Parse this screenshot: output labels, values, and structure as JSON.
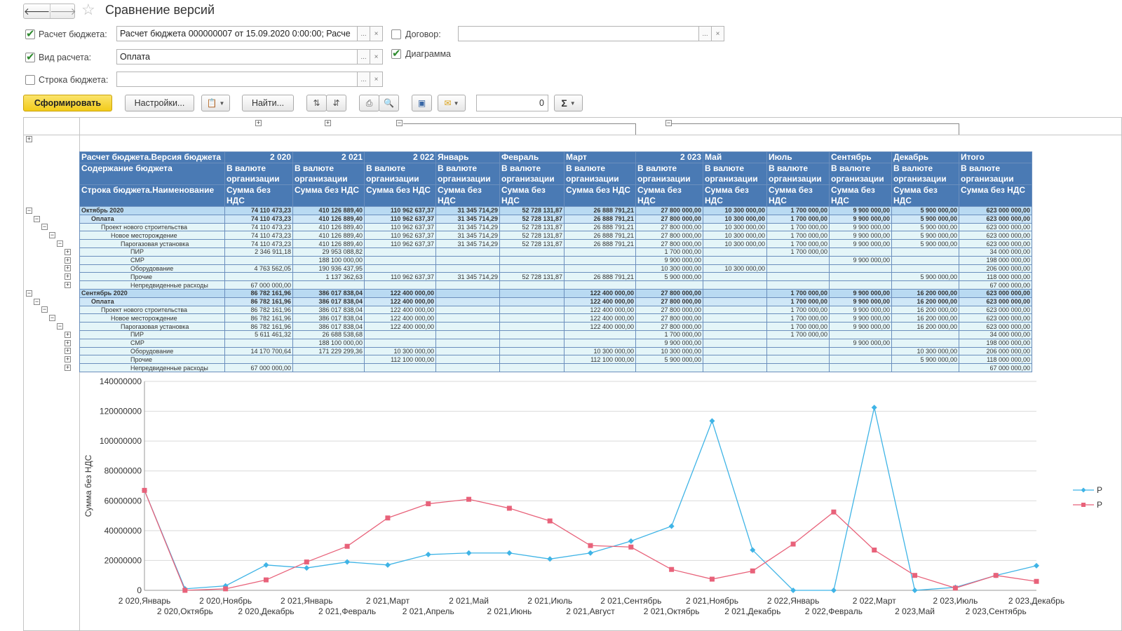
{
  "window": {
    "title": "Сравнение версий",
    "back_icon": "arrow-left-icon",
    "forward_icon": "arrow-right-icon"
  },
  "filters": {
    "budget_calc": {
      "label": "Расчет бюджета:",
      "checked": true,
      "value": "Расчет бюджета 000000007 от 15.09.2020 0:00:00; Расче",
      "btn_more": "...",
      "btn_clear": "×"
    },
    "calc_type": {
      "label": "Вид расчета:",
      "checked": true,
      "value": "Оплата",
      "btn_more": "...",
      "btn_clear": "×"
    },
    "budget_line": {
      "label": "Строка бюджета:",
      "checked": false,
      "value": "",
      "btn_more": "...",
      "btn_clear": "×"
    },
    "contract": {
      "label": "Договор:",
      "checked": false,
      "value": "",
      "btn_more": "...",
      "btn_clear": "×"
    },
    "diagram": {
      "label": "Диаграмма",
      "checked": true
    }
  },
  "toolbar": {
    "generate": "Сформировать",
    "settings": "Настройки...",
    "find": "Найти...",
    "counter": "0",
    "sum_symbol": "Σ",
    "primary_color": "#f5d12c"
  },
  "report": {
    "header_row1": [
      "Расчет бюджета.Версия бюджета",
      "2 020",
      "2 021",
      "2 022",
      "Январь",
      "Февраль",
      "Март",
      "2 023",
      "Май",
      "Июль",
      "Сентябрь",
      "Декабрь",
      "Итого"
    ],
    "header_row2_label": "Содержание бюджета",
    "header_row2_cell": "В валюте организации",
    "header_row3_label": "Строка бюджета.Наименование",
    "header_row3_cell": "Сумма без НДС",
    "rows": [
      {
        "level": 0,
        "name": "Октябрь 2020",
        "values": [
          "74 110 473,23",
          "410 126 889,40",
          "110 962 637,37",
          "31 345 714,29",
          "52 728 131,87",
          "26 888 791,21",
          "27 800 000,00",
          "10 300 000,00",
          "1 700 000,00",
          "9 900 000,00",
          "5 900 000,00",
          "623 000 000,00"
        ]
      },
      {
        "level": 1,
        "name": "Оплата",
        "values": [
          "74 110 473,23",
          "410 126 889,40",
          "110 962 637,37",
          "31 345 714,29",
          "52 728 131,87",
          "26 888 791,21",
          "27 800 000,00",
          "10 300 000,00",
          "1 700 000,00",
          "9 900 000,00",
          "5 900 000,00",
          "623 000 000,00"
        ]
      },
      {
        "level": 2,
        "name": "Проект нового строительства",
        "values": [
          "74 110 473,23",
          "410 126 889,40",
          "110 962 637,37",
          "31 345 714,29",
          "52 728 131,87",
          "26 888 791,21",
          "27 800 000,00",
          "10 300 000,00",
          "1 700 000,00",
          "9 900 000,00",
          "5 900 000,00",
          "623 000 000,00"
        ]
      },
      {
        "level": 3,
        "name": "Новое месторождение",
        "values": [
          "74 110 473,23",
          "410 126 889,40",
          "110 962 637,37",
          "31 345 714,29",
          "52 728 131,87",
          "26 888 791,21",
          "27 800 000,00",
          "10 300 000,00",
          "1 700 000,00",
          "9 900 000,00",
          "5 900 000,00",
          "623 000 000,00"
        ]
      },
      {
        "level": 4,
        "name": "Парогазовая установка",
        "values": [
          "74 110 473,23",
          "410 126 889,40",
          "110 962 637,37",
          "31 345 714,29",
          "52 728 131,87",
          "26 888 791,21",
          "27 800 000,00",
          "10 300 000,00",
          "1 700 000,00",
          "9 900 000,00",
          "5 900 000,00",
          "623 000 000,00"
        ]
      },
      {
        "level": 5,
        "name": "ПИР",
        "values": [
          "2 346 911,18",
          "29 953 088,82",
          "",
          "",
          "",
          "",
          "1 700 000,00",
          "",
          "1 700 000,00",
          "",
          "",
          "34 000 000,00"
        ]
      },
      {
        "level": 5,
        "name": "СМР",
        "values": [
          "",
          "188 100 000,00",
          "",
          "",
          "",
          "",
          "9 900 000,00",
          "",
          "",
          "9 900 000,00",
          "",
          "198 000 000,00"
        ]
      },
      {
        "level": 5,
        "name": "Оборудование",
        "values": [
          "4 763 562,05",
          "190 936 437,95",
          "",
          "",
          "",
          "",
          "10 300 000,00",
          "10 300 000,00",
          "",
          "",
          "",
          "206 000 000,00"
        ]
      },
      {
        "level": 5,
        "name": "Прочие",
        "values": [
          "",
          "1 137 362,63",
          "110 962 637,37",
          "31 345 714,29",
          "52 728 131,87",
          "26 888 791,21",
          "5 900 000,00",
          "",
          "",
          "",
          "5 900 000,00",
          "118 000 000,00"
        ]
      },
      {
        "level": 5,
        "name": "Непредвиденные расходы",
        "values": [
          "67 000 000,00",
          "",
          "",
          "",
          "",
          "",
          "",
          "",
          "",
          "",
          "",
          "67 000 000,00"
        ]
      },
      {
        "level": 0,
        "name": "Сентябрь 2020",
        "values": [
          "86 782 161,96",
          "386 017 838,04",
          "122 400 000,00",
          "",
          "",
          "122 400 000,00",
          "27 800 000,00",
          "",
          "1 700 000,00",
          "9 900 000,00",
          "16 200 000,00",
          "623 000 000,00"
        ]
      },
      {
        "level": 1,
        "name": "Оплата",
        "values": [
          "86 782 161,96",
          "386 017 838,04",
          "122 400 000,00",
          "",
          "",
          "122 400 000,00",
          "27 800 000,00",
          "",
          "1 700 000,00",
          "9 900 000,00",
          "16 200 000,00",
          "623 000 000,00"
        ]
      },
      {
        "level": 2,
        "name": "Проект нового строительства",
        "values": [
          "86 782 161,96",
          "386 017 838,04",
          "122 400 000,00",
          "",
          "",
          "122 400 000,00",
          "27 800 000,00",
          "",
          "1 700 000,00",
          "9 900 000,00",
          "16 200 000,00",
          "623 000 000,00"
        ]
      },
      {
        "level": 3,
        "name": "Новое месторождение",
        "values": [
          "86 782 161,96",
          "386 017 838,04",
          "122 400 000,00",
          "",
          "",
          "122 400 000,00",
          "27 800 000,00",
          "",
          "1 700 000,00",
          "9 900 000,00",
          "16 200 000,00",
          "623 000 000,00"
        ]
      },
      {
        "level": 4,
        "name": "Парогазовая установка",
        "values": [
          "86 782 161,96",
          "386 017 838,04",
          "122 400 000,00",
          "",
          "",
          "122 400 000,00",
          "27 800 000,00",
          "",
          "1 700 000,00",
          "9 900 000,00",
          "16 200 000,00",
          "623 000 000,00"
        ]
      },
      {
        "level": 5,
        "name": "ПИР",
        "values": [
          "5 611 461,32",
          "26 688 538,68",
          "",
          "",
          "",
          "",
          "1 700 000,00",
          "",
          "1 700 000,00",
          "",
          "",
          "34 000 000,00"
        ]
      },
      {
        "level": 5,
        "name": "СМР",
        "values": [
          "",
          "188 100 000,00",
          "",
          "",
          "",
          "",
          "9 900 000,00",
          "",
          "",
          "9 900 000,00",
          "",
          "198 000 000,00"
        ]
      },
      {
        "level": 5,
        "name": "Оборудование",
        "values": [
          "14 170 700,64",
          "171 229 299,36",
          "10 300 000,00",
          "",
          "",
          "10 300 000,00",
          "10 300 000,00",
          "",
          "",
          "",
          "10 300 000,00",
          "206 000 000,00"
        ]
      },
      {
        "level": 5,
        "name": "Прочие",
        "values": [
          "",
          "",
          "112 100 000,00",
          "",
          "",
          "112 100 000,00",
          "5 900 000,00",
          "",
          "",
          "",
          "5 900 000,00",
          "118 000 000,00"
        ]
      },
      {
        "level": 5,
        "name": "Непредвиденные расходы",
        "values": [
          "67 000 000,00",
          "",
          "",
          "",
          "",
          "",
          "",
          "",
          "",
          "",
          "",
          "67 000 000,00"
        ]
      }
    ]
  },
  "chart_data": {
    "type": "line",
    "ylabel": "Сумма без НДС",
    "xlabel": "",
    "ylim": [
      0,
      140000000
    ],
    "yticks": [
      0,
      20000000,
      40000000,
      60000000,
      80000000,
      100000000,
      120000000,
      140000000
    ],
    "grid": true,
    "legend": "right",
    "categories": [
      "2 020,Январь",
      "2 020,Октябрь",
      "2 020,Ноябрь",
      "2 020,Декабрь",
      "2 021,Январь",
      "2 021,Февраль",
      "2 021,Март",
      "2 021,Апрель",
      "2 021,Май",
      "2 021,Июнь",
      "2 021,Июль",
      "2 021,Август",
      "2 021,Сентябрь",
      "2 021,Октябрь",
      "2 021,Ноябрь",
      "2 021,Декабрь",
      "2 022,Январь",
      "2 022,Февраль",
      "2 022,Март",
      "2 023,Май",
      "2 023,Июль",
      "2 023,Сентябрь",
      "2 023,Декабрь"
    ],
    "series": [
      {
        "name": "Р",
        "color": "#3fb4e6",
        "marker": "diamond",
        "values": [
          67000000,
          1000000,
          3000000,
          17000000,
          15000000,
          19000000,
          17000000,
          24000000,
          25000000,
          25000000,
          21000000,
          25000000,
          33000000,
          43000000,
          113500000,
          27000000,
          0,
          0,
          122500000,
          0,
          2000000,
          10000000,
          16500000
        ]
      },
      {
        "name": "Р",
        "color": "#e8627a",
        "marker": "square",
        "values": [
          67000000,
          0,
          1000000,
          7000000,
          19000000,
          29500000,
          48500000,
          58000000,
          61000000,
          55000000,
          46500000,
          30000000,
          29000000,
          14000000,
          7500000,
          13000000,
          31000000,
          52500000,
          27000000,
          10000000,
          1500000,
          10000000,
          6000000
        ]
      }
    ]
  }
}
